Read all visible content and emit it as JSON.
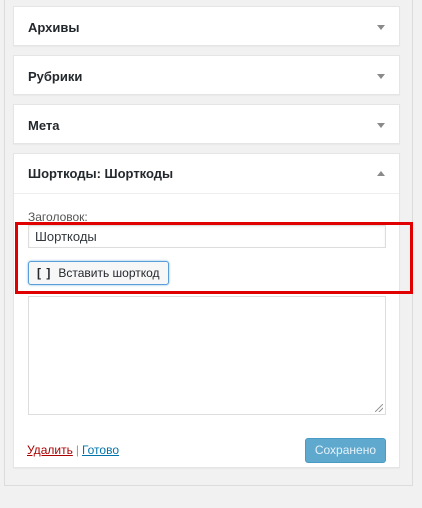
{
  "widgets": [
    {
      "title": "Архивы"
    },
    {
      "title": "Рубрики"
    },
    {
      "title": "Мета"
    }
  ],
  "shortcode_widget": {
    "title": "Шорткоды: Шорткоды",
    "field_label": "Заголовок:",
    "title_value": "Шорткоды",
    "insert_button": "Вставить шорткод",
    "delete_link": "Удалить",
    "separator": "|",
    "done_link": "Готово",
    "save_button": "Сохранено"
  },
  "colors": {
    "highlight": "#e00000",
    "save_button": "#5fa9cf",
    "delete_link": "#aa0000",
    "done_link": "#0073aa"
  }
}
